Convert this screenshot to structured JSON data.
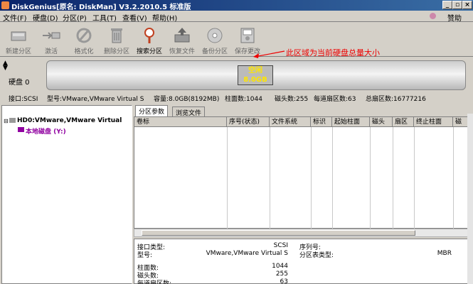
{
  "window": {
    "title": "DiskGenius[原名: DiskMan] V3.2.2010.5 标准版",
    "min": "_",
    "max": "▫",
    "close": "×"
  },
  "menu": {
    "items": [
      "文件(F)",
      "硬盘(D)",
      "分区(P)",
      "工具(T)",
      "查看(V)",
      "帮助(H)"
    ],
    "donate": "赞助"
  },
  "toolbar": {
    "buttons": [
      {
        "label": "新建分区",
        "icon": "new-partition-icon"
      },
      {
        "label": "激活",
        "icon": "activate-icon"
      },
      {
        "label": "格式化",
        "icon": "format-icon"
      },
      {
        "label": "删除分区",
        "icon": "delete-partition-icon"
      },
      {
        "label": "搜索分区",
        "icon": "search-partition-icon"
      },
      {
        "label": "恢复文件",
        "icon": "recover-files-icon"
      },
      {
        "label": "备份分区",
        "icon": "backup-partition-icon"
      },
      {
        "label": "保存更改",
        "icon": "save-changes-icon"
      }
    ],
    "annotation": "此区域为当前硬盘总量大小"
  },
  "disk": {
    "label": "硬盘 0",
    "free_label": "空闲",
    "free_size": "8.0GB"
  },
  "info": {
    "interface": "接口:SCSI",
    "model": "型号:VMware,VMware Virtual S",
    "capacity": "容量:8.0GB(8192MB)",
    "cylinders": "柱面数:1044",
    "heads": "磁头数:255",
    "sectors_per_track": "每道扇区数:63",
    "total_sectors": "总扇区数:16777216"
  },
  "tree": {
    "disk": "HD0:VMware,VMware Virtual",
    "local": "本地磁盘 (Y:)"
  },
  "tabs": [
    "分区参数",
    "浏览文件"
  ],
  "grid": {
    "columns": [
      "卷标",
      "序号(状态)",
      "文件系统",
      "标识",
      "起始柱面",
      "磁头",
      "扇区",
      "终止柱面",
      "磁"
    ]
  },
  "details": {
    "interface_type_label": "接口类型:",
    "interface_type_value": "SCSI",
    "model_label": "型号:",
    "model_value": "VMware,VMware Virtual S",
    "serial_label": "序列号:",
    "partition_table_label": "分区表类型:",
    "partition_table_value": "MBR",
    "cylinders_label": "柱面数:",
    "cylinders_value": "1044",
    "heads_label": "磁头数:",
    "heads_value": "255",
    "spt_label": "每道扇区数:",
    "spt_value": "63"
  },
  "colors": {
    "titlebar": "#0a246a",
    "annotation": "#e00000",
    "free_text": "#ffe600"
  }
}
